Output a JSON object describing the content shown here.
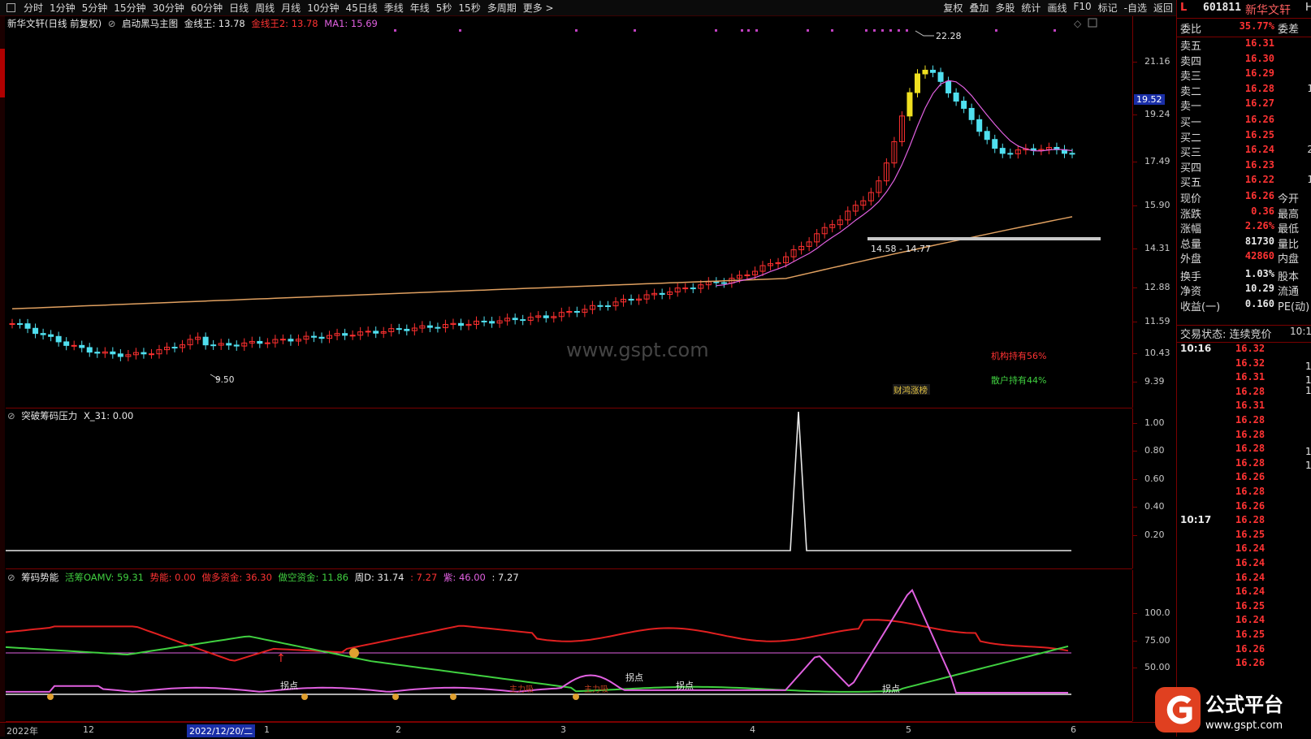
{
  "toolbar": {
    "periods": [
      "分时",
      "1分钟",
      "5分钟",
      "15分钟",
      "30分钟",
      "60分钟",
      "日线",
      "周线",
      "月线",
      "10分钟",
      "45日线",
      "季线",
      "年线",
      "5秒",
      "15秒",
      "多周期",
      "更多 >"
    ],
    "tools": [
      "复权",
      "叠加",
      "多股",
      "统计",
      "画线",
      "F10",
      "标记",
      "-自选",
      "返回"
    ]
  },
  "stock": {
    "marker": "L",
    "code": "601811",
    "name": "新华文轩",
    "badge": "H"
  },
  "main_title": {
    "name": "新华文轩(日线 前复权)",
    "indicator": "启动黑马主图",
    "jxw": "金线王: 13.78",
    "jxw2": "金线王2: 13.78",
    "ma1": "MA1: 15.69"
  },
  "price_axis": {
    "labels": [
      "21.16",
      "19.24",
      "17.49",
      "15.90",
      "14.31",
      "12.88",
      "11.59",
      "10.43",
      "9.39"
    ],
    "highlight": "19.52"
  },
  "annotations": {
    "high": "22.28",
    "low": "9.50",
    "range": "14.58 - 14.77",
    "institution": "机构持有56%",
    "retail": "散户持有44%",
    "event": "财鸿涨榜",
    "watermark": "www.gspt.com"
  },
  "sub1": {
    "name": "突破筹码压力",
    "value": "X_31: 0.00",
    "axis": [
      "1.00",
      "0.80",
      "0.60",
      "0.40",
      "0.20"
    ]
  },
  "sub2": {
    "name": "筹码势能",
    "huochou": "活筹OAMV: 59.31",
    "shineng": "势能: 0.00",
    "zuoduo": "做多资金: 36.30",
    "zuokong": "做空资金: 11.86",
    "zhoud": "周D: 31.74",
    "v1": ": 7.27",
    "zi": "紫: 46.00",
    "v2": ": 7.27",
    "axis": [
      "100.0",
      "75.00",
      "50.00"
    ],
    "labels": [
      "拐点",
      "拐点",
      "拐点",
      "拐点",
      "主力吸",
      "主力吸"
    ]
  },
  "date_axis": {
    "labels": [
      "2022年",
      "12",
      "2022/12/20/二",
      "1",
      "2",
      "3",
      "4",
      "5",
      "6"
    ]
  },
  "quote": {
    "weibi_label": "委比",
    "weibi": "35.77%",
    "weicha_label": "委差",
    "asks": [
      {
        "l": "卖五",
        "p": "16.31",
        "v": ""
      },
      {
        "l": "卖四",
        "p": "16.30",
        "v": ""
      },
      {
        "l": "卖三",
        "p": "16.29",
        "v": ""
      },
      {
        "l": "卖二",
        "p": "16.28",
        "v": "1"
      },
      {
        "l": "卖一",
        "p": "16.27",
        "v": ""
      }
    ],
    "bids": [
      {
        "l": "买一",
        "p": "16.26",
        "v": ""
      },
      {
        "l": "买二",
        "p": "16.25",
        "v": ""
      },
      {
        "l": "买三",
        "p": "16.24",
        "v": "2"
      },
      {
        "l": "买四",
        "p": "16.23",
        "v": ""
      },
      {
        "l": "买五",
        "p": "16.22",
        "v": "1"
      }
    ],
    "stats": [
      {
        "l": "现价",
        "v": "16.26",
        "r": "今开",
        "c": "up"
      },
      {
        "l": "涨跌",
        "v": "0.36",
        "r": "最高",
        "c": "up"
      },
      {
        "l": "涨幅",
        "v": "2.26%",
        "r": "最低",
        "c": "up"
      },
      {
        "l": "总量",
        "v": "81730",
        "r": "量比",
        "c": "wh"
      },
      {
        "l": "外盘",
        "v": "42860",
        "r": "内盘",
        "c": "up"
      },
      {
        "l": "换手",
        "v": "1.03%",
        "r": "股本",
        "c": "wh"
      },
      {
        "l": "净资",
        "v": "10.29",
        "r": "流通",
        "c": "wh"
      },
      {
        "l": "收益(一)",
        "v": "0.160",
        "r": "PE(动)",
        "c": "wh"
      }
    ],
    "status": "交易状态: 连续竞价",
    "status_time": "10:1"
  },
  "ticks": [
    {
      "t": "10:16",
      "p": "16.32"
    },
    {
      "t": "",
      "p": "16.32"
    },
    {
      "t": "",
      "p": "16.31"
    },
    {
      "t": "",
      "p": "16.28"
    },
    {
      "t": "",
      "p": "16.31"
    },
    {
      "t": "",
      "p": "16.28"
    },
    {
      "t": "",
      "p": "16.28"
    },
    {
      "t": "",
      "p": "16.28"
    },
    {
      "t": "",
      "p": "16.28"
    },
    {
      "t": "",
      "p": "16.26"
    },
    {
      "t": "",
      "p": "16.28"
    },
    {
      "t": "",
      "p": "16.26"
    },
    {
      "t": "10:17",
      "p": "16.28"
    },
    {
      "t": "",
      "p": "16.25"
    },
    {
      "t": "",
      "p": "16.24"
    },
    {
      "t": "",
      "p": "16.24"
    },
    {
      "t": "",
      "p": "16.24"
    },
    {
      "t": "",
      "p": "16.24"
    },
    {
      "t": "",
      "p": "16.25"
    },
    {
      "t": "",
      "p": "16.24"
    },
    {
      "t": "",
      "p": "16.25"
    },
    {
      "t": "",
      "p": "16.26"
    },
    {
      "t": "",
      "p": "16.26"
    }
  ],
  "tick_side": [
    "1",
    "1",
    "1",
    "",
    "1",
    "1"
  ],
  "logo": {
    "text": "公式平台",
    "url": "www.gspt.com"
  }
}
